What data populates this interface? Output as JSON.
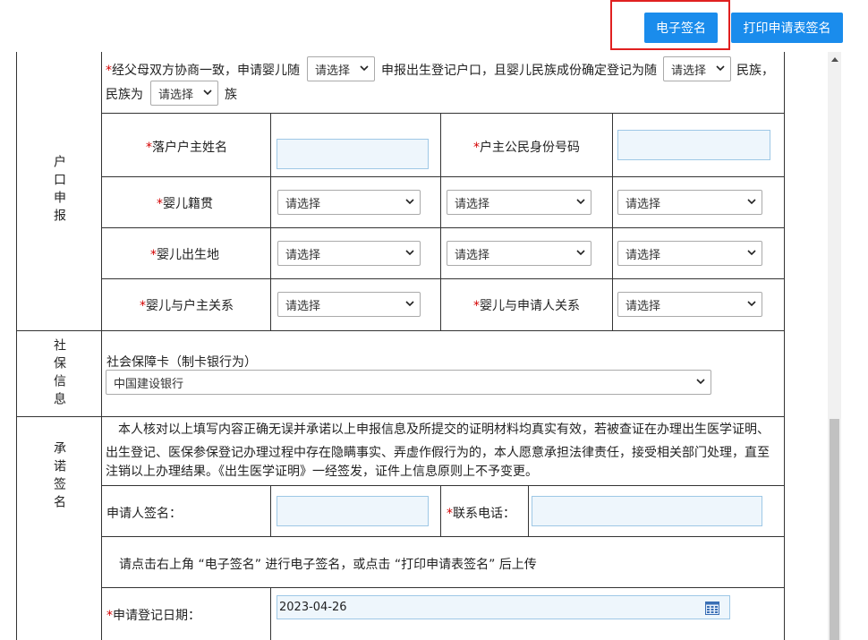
{
  "toolbar": {
    "esign_label": "电子签名",
    "print_label": "打印申请表签名"
  },
  "household": {
    "section_label": "户口申报",
    "intro_pre": "经父母双方协商一致，申请婴儿随",
    "intro_mid": "申报出生登记户口，且婴儿民族成份确定登记为随",
    "intro_post": "民族，",
    "ethnic_pre": "民族为",
    "ethnic_post": "族",
    "select_placeholder": "请选择",
    "head_name_label": "落户户主姓名",
    "head_id_label": "户主公民身份号码",
    "native_place_label": "婴儿籍贯",
    "birthplace_label": "婴儿出生地",
    "relation_head_label": "婴儿与户主关系",
    "relation_applicant_label": "婴儿与申请人关系"
  },
  "social": {
    "section_label": "社保信息",
    "card_label": "社会保障卡（制卡银行为）",
    "bank_value": "中国建设银行"
  },
  "pledge": {
    "section_label": "承诺签名",
    "line1": "本人核对以上填写内容正确无误并承诺以上申报信息及所提交的证明材料均真实有效，若被查证在办理出生医学证明、",
    "line2": "出生登记、医保参保登记办理过程中存在隐瞒事实、弄虚作假行为的，本人愿意承担法律责任，接受相关部门处理，直至",
    "line3": "注销以上办理结果。《出生医学证明》一经签发，证件上信息原则上不予变更。",
    "applicant_sign_label": "申请人签名：",
    "phone_label": "联系电话：",
    "instruction": "请点击右上角 “电子签名” 进行电子签名，或点击 “打印申请表签名” 后上传",
    "date_label": "申请登记日期：",
    "date_value": "2023-04-26"
  },
  "required_mark": "*"
}
